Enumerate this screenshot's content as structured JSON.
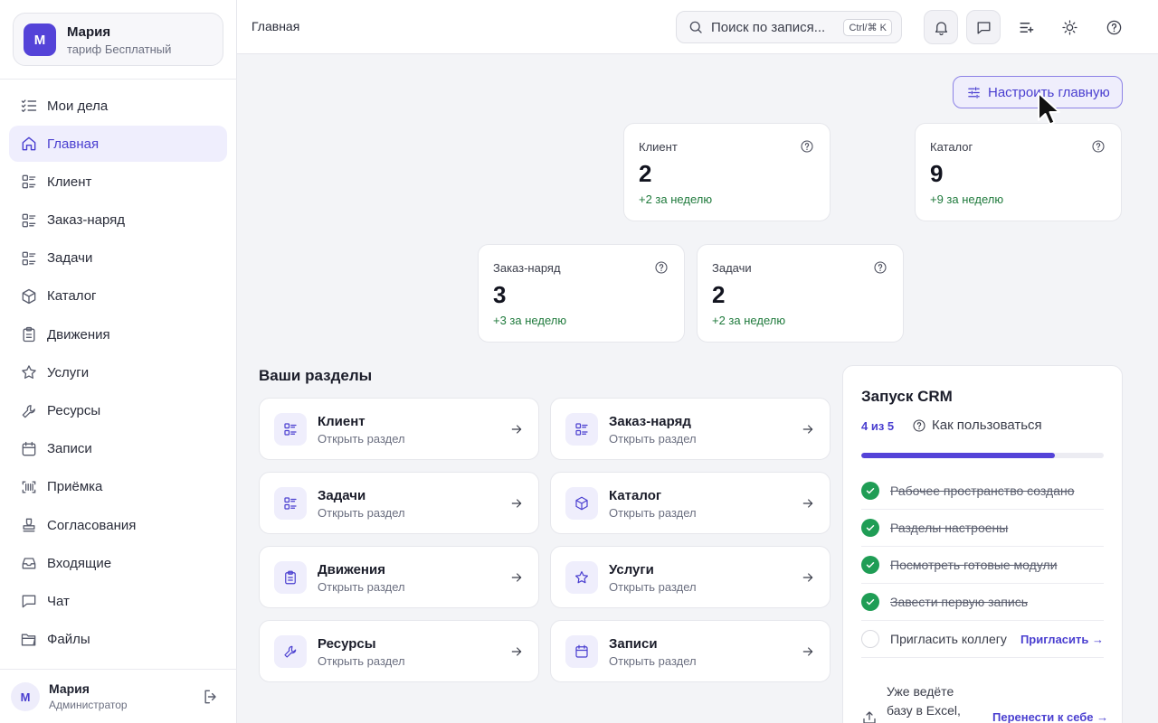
{
  "account": {
    "avatar": "М",
    "name": "Мария",
    "plan": "тариф Бесплатный"
  },
  "nav": [
    {
      "label": "Мои дела",
      "icon": "task-list-icon"
    },
    {
      "label": "Главная",
      "icon": "home-icon",
      "active": true
    },
    {
      "label": "Клиент",
      "icon": "grid-list-icon"
    },
    {
      "label": "Заказ-наряд",
      "icon": "grid-list-icon"
    },
    {
      "label": "Задачи",
      "icon": "grid-list-icon"
    },
    {
      "label": "Каталог",
      "icon": "box-icon"
    },
    {
      "label": "Движения",
      "icon": "clipboard-icon"
    },
    {
      "label": "Услуги",
      "icon": "star-icon"
    },
    {
      "label": "Ресурсы",
      "icon": "wrench-icon"
    },
    {
      "label": "Записи",
      "icon": "calendar-icon"
    },
    {
      "label": "Приёмка",
      "icon": "scan-icon"
    },
    {
      "label": "Согласования",
      "icon": "stamp-icon"
    },
    {
      "label": "Входящие",
      "icon": "inbox-icon"
    },
    {
      "label": "Чат",
      "icon": "chat-icon"
    },
    {
      "label": "Файлы",
      "icon": "folder-icon"
    }
  ],
  "user": {
    "avatar": "М",
    "name": "Мария",
    "role": "Администратор"
  },
  "header": {
    "breadcrumb": "Главная",
    "search_placeholder": "Поиск по запися...",
    "search_shortcut": "Ctrl/⌘ K"
  },
  "customize_label": "Настроить главную",
  "stats": [
    {
      "label": "Клиент",
      "value": "2",
      "delta": "+2 за неделю"
    },
    {
      "label": "Каталог",
      "value": "9",
      "delta": "+9 за неделю"
    },
    {
      "label": "Заказ-наряд",
      "value": "3",
      "delta": "+3 за неделю"
    },
    {
      "label": "Задачи",
      "value": "2",
      "delta": "+2 за неделю"
    }
  ],
  "sections_title": "Ваши разделы",
  "sections": [
    {
      "title": "Клиент",
      "sub": "Открыть раздел",
      "icon": "grid-list-icon"
    },
    {
      "title": "Заказ-наряд",
      "sub": "Открыть раздел",
      "icon": "grid-list-icon"
    },
    {
      "title": "Задачи",
      "sub": "Открыть раздел",
      "icon": "grid-list-icon"
    },
    {
      "title": "Каталог",
      "sub": "Открыть раздел",
      "icon": "box-icon"
    },
    {
      "title": "Движения",
      "sub": "Открыть раздел",
      "icon": "clipboard-icon"
    },
    {
      "title": "Услуги",
      "sub": "Открыть раздел",
      "icon": "star-icon"
    },
    {
      "title": "Ресурсы",
      "sub": "Открыть раздел",
      "icon": "wrench-icon"
    },
    {
      "title": "Записи",
      "sub": "Открыть раздел",
      "icon": "calendar-icon"
    }
  ],
  "crm": {
    "title": "Запуск CRM",
    "count": "4 из 5",
    "how": "Как пользоваться",
    "progress": 0.8,
    "steps": [
      {
        "label": "Рабочее пространство создано",
        "done": true
      },
      {
        "label": "Разделы настроены",
        "done": true
      },
      {
        "label": "Посмотреть готовые модули",
        "done": true
      },
      {
        "label": "Завести первую запись",
        "done": true
      },
      {
        "label": "Пригласить коллегу",
        "done": false,
        "link": "Пригласить →"
      }
    ],
    "import_text": "Уже ведёте базу в Excel, CSV",
    "import_link": "Перенести к себе →"
  },
  "colors": {
    "accent": "#5443d8",
    "success": "#1f9d55",
    "delta": "#1f7a3c"
  }
}
